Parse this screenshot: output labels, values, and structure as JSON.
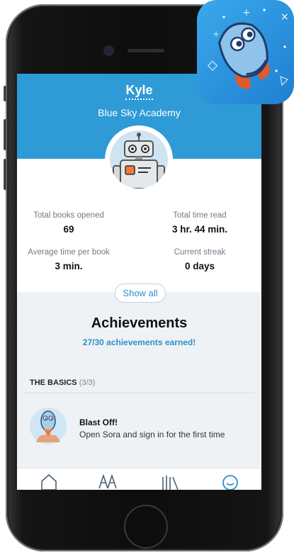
{
  "profile": {
    "name": "Kyle",
    "school": "Blue Sky Academy"
  },
  "stats": [
    {
      "label": "Total books opened",
      "value": "69"
    },
    {
      "label": "Total time read",
      "value": "3 hr. 44 min."
    },
    {
      "label": "Average time per book",
      "value": "3 min."
    },
    {
      "label": "Current streak",
      "value": "0 days"
    }
  ],
  "show_all_label": "Show all",
  "achievements": {
    "title": "Achievements",
    "earned": "27/30 achievements earned!",
    "section": {
      "name": "THE BASICS",
      "count": "(3/3)"
    },
    "items": [
      {
        "name": "Blast Off!",
        "description": "Open Sora and sign in for the first time"
      }
    ]
  },
  "tabs": [
    "home-icon",
    "library-icon",
    "shelf-icon",
    "profile-icon"
  ],
  "colors": {
    "header": "#2e9ad6",
    "accent": "#2e8fcc"
  }
}
